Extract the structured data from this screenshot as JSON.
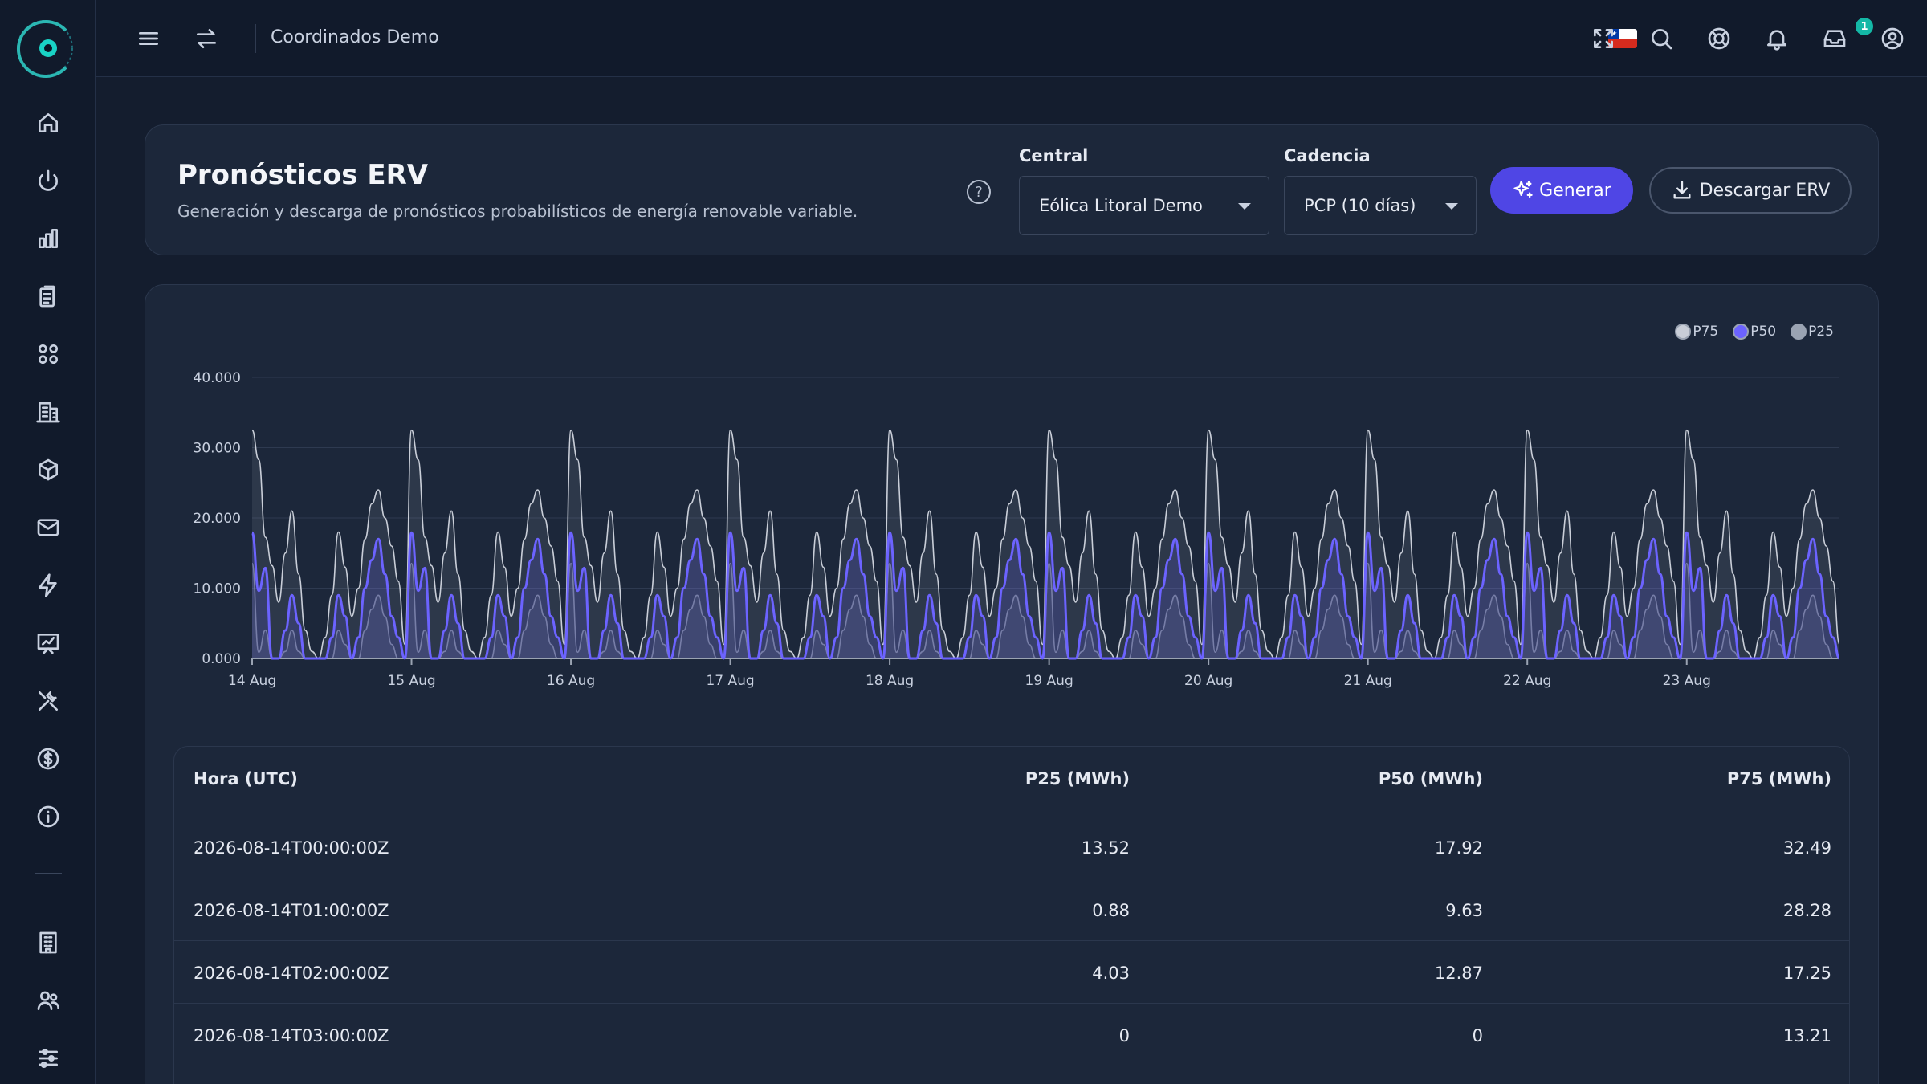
{
  "app": {
    "title": "Coordinados Demo",
    "notification_count": "1",
    "flag": "chile-flag-icon"
  },
  "sidebar": {
    "items": [
      {
        "name": "home-icon"
      },
      {
        "name": "power-icon"
      },
      {
        "name": "bar-chart-icon"
      },
      {
        "name": "clipboard-icon"
      },
      {
        "name": "grid-icon"
      },
      {
        "name": "building-icon"
      },
      {
        "name": "cube-icon"
      },
      {
        "name": "mail-icon"
      },
      {
        "name": "bolt-icon"
      },
      {
        "name": "presentation-chart-icon"
      },
      {
        "name": "tools-icon"
      },
      {
        "name": "dollar-icon"
      },
      {
        "name": "info-icon"
      },
      {
        "name": "office-icon"
      },
      {
        "name": "users-icon"
      },
      {
        "name": "sliders-icon"
      }
    ]
  },
  "header": {
    "title": "Pronósticos ERV",
    "subtitle": "Generación y descarga de pronósticos probabilísticos de energía renovable variable.",
    "central_label": "Central",
    "central_value": "Eólica Litoral Demo",
    "cadencia_label": "Cadencia",
    "cadencia_value": "PCP (10 días)",
    "generate_label": "Generar",
    "download_label": "Descargar ERV"
  },
  "colors": {
    "accent": "#4f46e5",
    "p50_line": "#6c63ff",
    "p75_line": "#c9ced8",
    "background": "#141d2e",
    "card": "#1c273a"
  },
  "chart_data": {
    "type": "area",
    "x": [
      "14 Aug",
      "15 Aug",
      "16 Aug",
      "17 Aug",
      "18 Aug",
      "19 Aug",
      "20 Aug",
      "21 Aug",
      "22 Aug",
      "23 Aug"
    ],
    "ytick_labels": [
      "0.000",
      "10.000",
      "20.000",
      "30.000",
      "40.000"
    ],
    "ylim": [
      0,
      40
    ],
    "grid": true,
    "legend_position": "top-right",
    "series": [
      {
        "name": "P75",
        "color": "#c9ced8",
        "daily_pattern": [
          32.49,
          28.28,
          17.25,
          13.21,
          8,
          15,
          21,
          12,
          4,
          1,
          0,
          3,
          9,
          18,
          13,
          6,
          10,
          17,
          22,
          24,
          20,
          16,
          11,
          2
        ]
      },
      {
        "name": "P50",
        "color": "#6c63ff",
        "daily_pattern": [
          17.92,
          9.63,
          12.87,
          0,
          0,
          4,
          9,
          5,
          0,
          0,
          0,
          0,
          3,
          9,
          6,
          0,
          3,
          10,
          14,
          17,
          12,
          6,
          3,
          0
        ]
      },
      {
        "name": "P25",
        "color": "#9aa3b2",
        "daily_pattern": [
          13.52,
          0.88,
          4.03,
          0,
          0,
          1,
          4,
          1,
          0,
          0,
          0,
          0,
          0,
          4,
          2,
          0,
          0,
          4,
          7,
          9,
          6,
          2,
          0,
          0
        ]
      }
    ]
  },
  "table": {
    "headers": [
      "Hora (UTC)",
      "P25 (MWh)",
      "P50 (MWh)",
      "P75 (MWh)"
    ],
    "rows": [
      [
        "2026-08-14T00:00:00Z",
        "13.52",
        "17.92",
        "32.49"
      ],
      [
        "2026-08-14T01:00:00Z",
        "0.88",
        "9.63",
        "28.28"
      ],
      [
        "2026-08-14T02:00:00Z",
        "4.03",
        "12.87",
        "17.25"
      ],
      [
        "2026-08-14T03:00:00Z",
        "0",
        "0",
        "13.21"
      ]
    ]
  }
}
